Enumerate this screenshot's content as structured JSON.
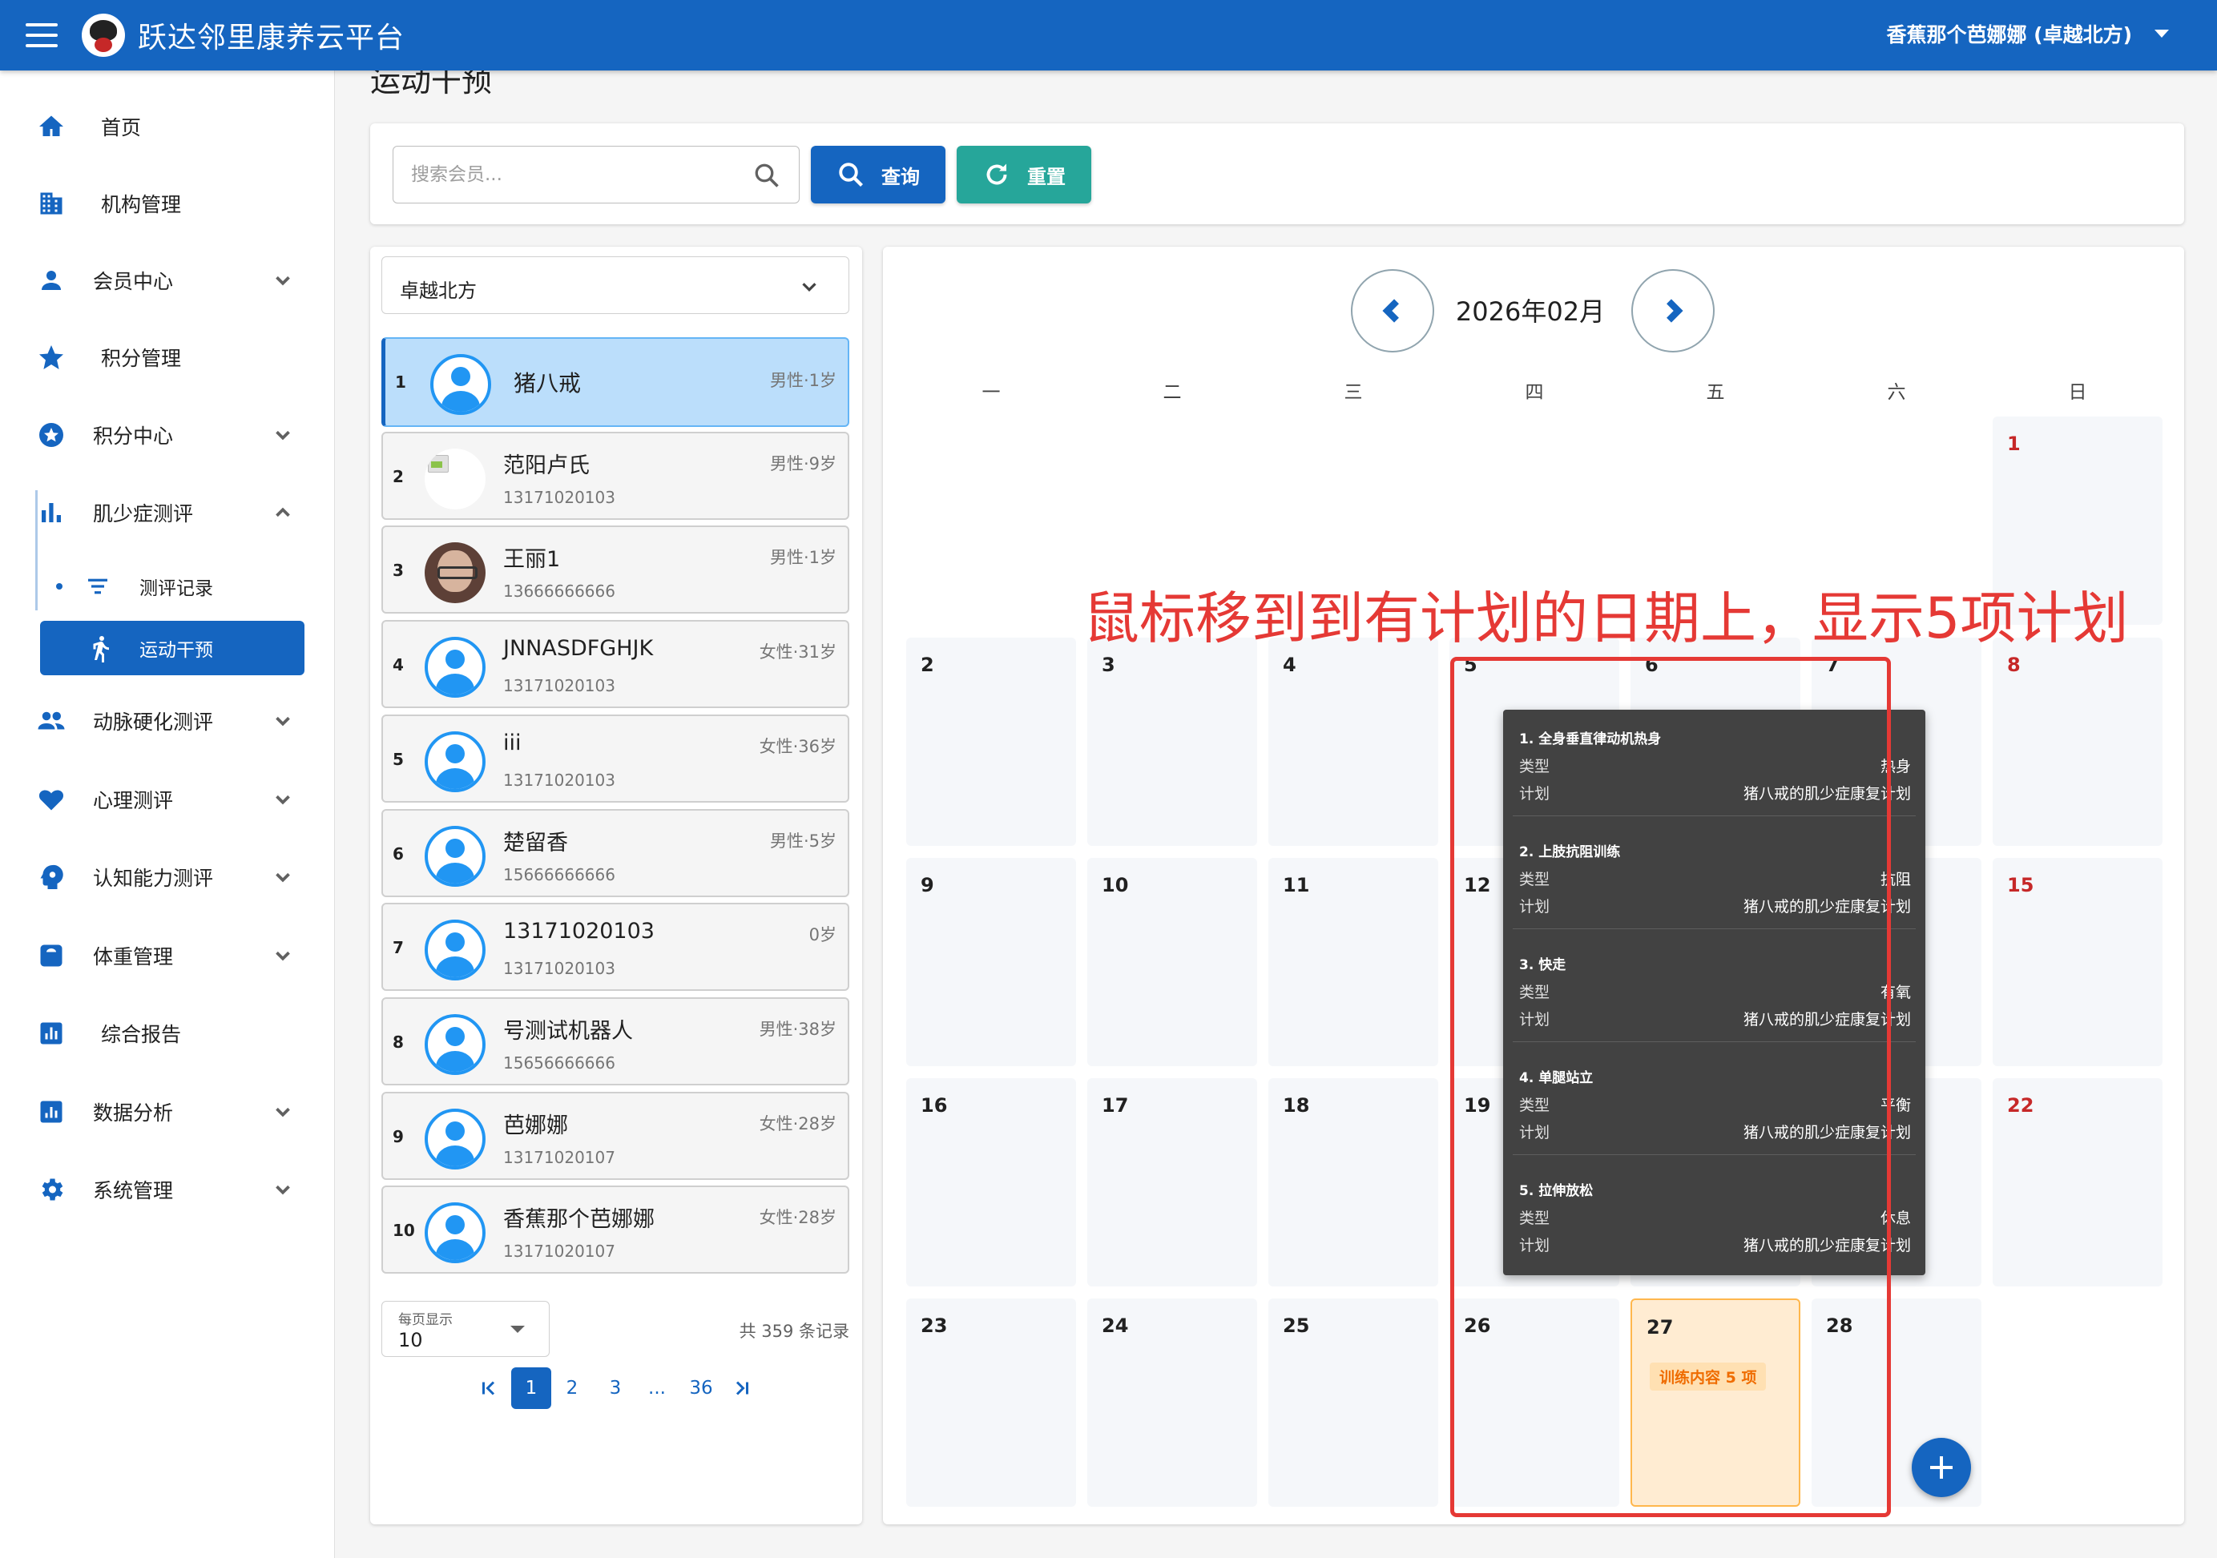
{
  "app": {
    "title": "跃达邻里康养云平台",
    "user": "香蕉那个芭娜娜 (卓越北方)"
  },
  "sidebar": {
    "items": [
      {
        "label": "首页",
        "icon": "home-icon"
      },
      {
        "label": "机构管理",
        "icon": "building-icon"
      },
      {
        "label": "会员中心",
        "icon": "person-icon"
      },
      {
        "label": "积分管理",
        "icon": "star-icon"
      },
      {
        "label": "积分中心",
        "icon": "star-circle-icon"
      },
      {
        "label": "肌少症测评",
        "icon": "bar-chart-icon"
      },
      {
        "label": "动脉硬化测评",
        "icon": "people-icon"
      },
      {
        "label": "心理测评",
        "icon": "heart-icon"
      },
      {
        "label": "认知能力测评",
        "icon": "brain-icon"
      },
      {
        "label": "体重管理",
        "icon": "scale-icon"
      },
      {
        "label": "综合报告",
        "icon": "report-icon"
      },
      {
        "label": "数据分析",
        "icon": "analytics-icon"
      },
      {
        "label": "系统管理",
        "icon": "gear-icon"
      }
    ],
    "subitems": [
      {
        "label": "测评记录"
      },
      {
        "label": "运动干预"
      }
    ]
  },
  "page": {
    "title": "运动干预"
  },
  "search": {
    "placeholder": "搜索会员...",
    "query_label": "查询",
    "reset_label": "重置"
  },
  "org": {
    "selected": "卓越北方"
  },
  "members": [
    {
      "idx": "1",
      "name": "猪八戒",
      "info": "男性·1岁",
      "phone": ""
    },
    {
      "idx": "2",
      "name": "范阳卢氏",
      "info": "男性·9岁",
      "phone": "13171020103"
    },
    {
      "idx": "3",
      "name": "王丽1",
      "info": "男性·1岁",
      "phone": "13666666666"
    },
    {
      "idx": "4",
      "name": "JNNASDFGHJK",
      "info": "女性·31岁",
      "phone": "13171020103"
    },
    {
      "idx": "5",
      "name": "iii",
      "info": "女性·36岁",
      "phone": "13171020103"
    },
    {
      "idx": "6",
      "name": "楚留香",
      "info": "男性·5岁",
      "phone": "15666666666"
    },
    {
      "idx": "7",
      "name": "13171020103",
      "info": "0岁",
      "phone": "13171020103"
    },
    {
      "idx": "8",
      "name": "号测试机器人",
      "info": "男性·38岁",
      "phone": "15656666666"
    },
    {
      "idx": "9",
      "name": "芭娜娜",
      "info": "女性·28岁",
      "phone": "13171020107"
    },
    {
      "idx": "10",
      "name": "香蕉那个芭娜娜",
      "info": "女性·28岁",
      "phone": "13171020107"
    }
  ],
  "pagination": {
    "per_page_label": "每页显示",
    "per_page": "10",
    "total": "共 359 条记录",
    "pages": [
      "1",
      "2",
      "3",
      "...",
      "36"
    ],
    "current": "1"
  },
  "calendar": {
    "month": "2026年02月",
    "weekdays": [
      "一",
      "二",
      "三",
      "四",
      "五",
      "六",
      "日"
    ],
    "plan_badge": "训练内容 5 项"
  },
  "annotation": "鼠标移到到有计划的日期上，显示5项计划",
  "tooltip": {
    "type_key": "类型",
    "plan_key": "计划",
    "items": [
      {
        "title": "1. 全身垂直律动机热身",
        "type": "热身",
        "plan": "猪八戒的肌少症康复计划"
      },
      {
        "title": "2. 上肢抗阻训练",
        "type": "抗阻",
        "plan": "猪八戒的肌少症康复计划"
      },
      {
        "title": "3. 快走",
        "type": "有氧",
        "plan": "猪八戒的肌少症康复计划"
      },
      {
        "title": "4. 单腿站立",
        "type": "平衡",
        "plan": "猪八戒的肌少症康复计划"
      },
      {
        "title": "5. 拉伸放松",
        "type": "休息",
        "plan": "猪八戒的肌少症康复计划"
      }
    ]
  },
  "colors": {
    "primary": "#1565c0",
    "teal": "#26a69a",
    "danger": "#e53935",
    "plan": "#ffecd2"
  }
}
